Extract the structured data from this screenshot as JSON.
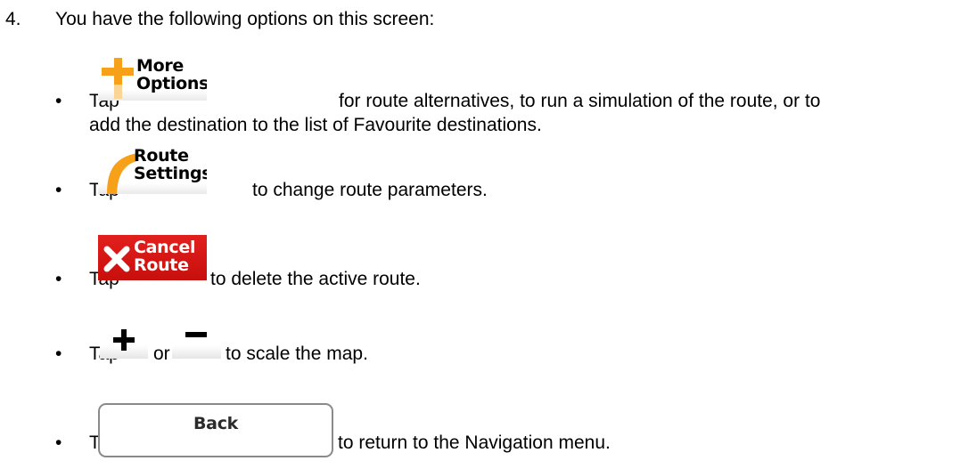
{
  "step": {
    "number": "4.",
    "intro": "You have the following options on this screen:"
  },
  "bullet_glyph": "•",
  "tap_word": "Tap",
  "items": [
    {
      "button": {
        "line1": "More",
        "line2": "Options",
        "icon": "plus-icon",
        "accent": "#f7a11a"
      },
      "text_line1": "for route alternatives, to run a simulation of the route, or to",
      "text_line2": "add the destination to the list of Favourite destinations."
    },
    {
      "button": {
        "line1": "Route",
        "line2": "Settings",
        "icon": "arc-icon",
        "accent": "#f7a11a"
      },
      "text_line1": "to change route parameters."
    },
    {
      "button": {
        "line1": "Cancel",
        "line2": "Route",
        "icon": "close-icon",
        "accent": "#d8150f"
      },
      "text_line1": "to delete the active route."
    },
    {
      "connector": "or",
      "zoom_in_icon": "plus-icon",
      "zoom_out_icon": "minus-icon",
      "text_line1": "to scale the map."
    },
    {
      "button": {
        "label": "Back"
      },
      "text_line1": "to return to the Navigation menu."
    }
  ]
}
